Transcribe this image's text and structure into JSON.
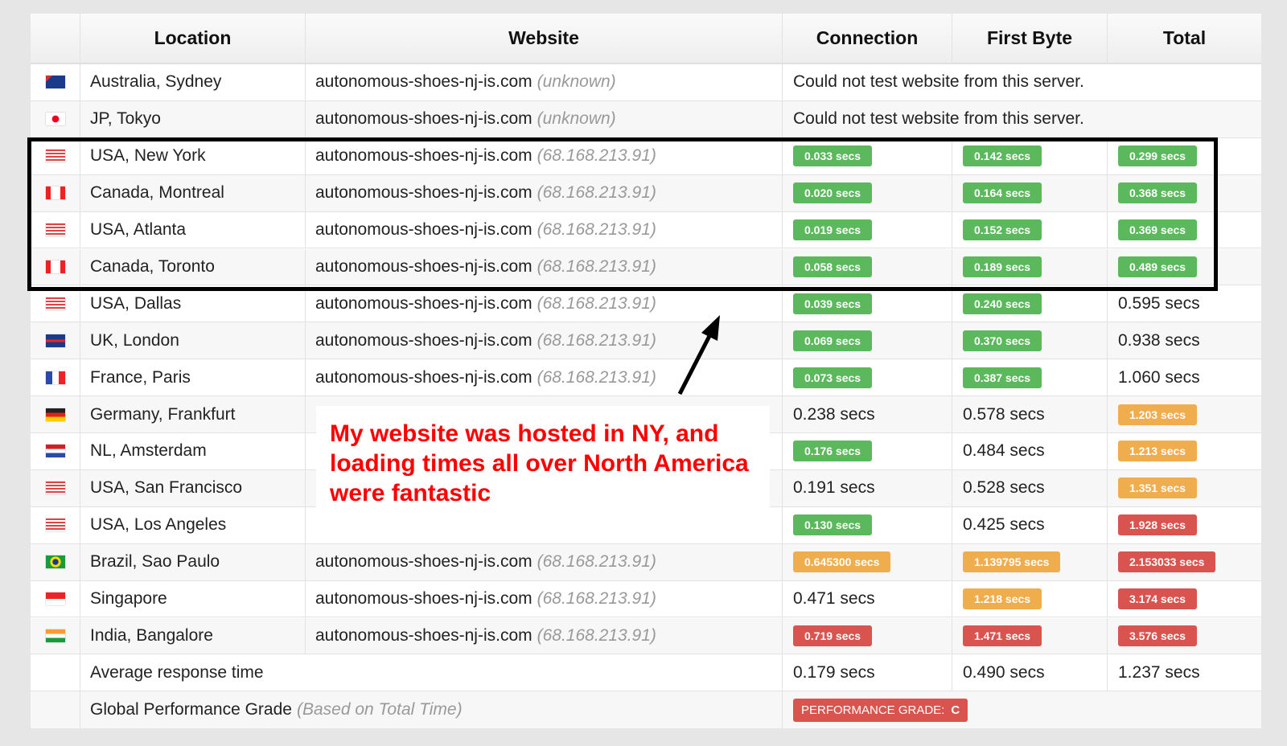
{
  "colors": {
    "good": "#5cb85c",
    "warn": "#f0ad4e",
    "bad": "#d9534f",
    "annotation": "#ff0000"
  },
  "headers": {
    "location": "Location",
    "website": "Website",
    "connection": "Connection",
    "first_byte": "First Byte",
    "total": "Total"
  },
  "rows": [
    {
      "flag": "australia",
      "location": "Australia, Sydney",
      "site": "autonomous-shoes-nj-is.com",
      "ip": "(unknown)",
      "message": "Could not test website from this server."
    },
    {
      "flag": "japan",
      "location": "JP, Tokyo",
      "site": "autonomous-shoes-nj-is.com",
      "ip": "(unknown)",
      "message": "Could not test website from this server."
    },
    {
      "flag": "usa",
      "location": "USA, New York",
      "site": "autonomous-shoes-nj-is.com",
      "ip": "(68.168.213.91)",
      "conn": {
        "v": "0.033 secs",
        "s": "green"
      },
      "fb": {
        "v": "0.142 secs",
        "s": "green"
      },
      "total": {
        "v": "0.299 secs",
        "s": "green"
      }
    },
    {
      "flag": "canada",
      "location": "Canada, Montreal",
      "site": "autonomous-shoes-nj-is.com",
      "ip": "(68.168.213.91)",
      "conn": {
        "v": "0.020 secs",
        "s": "green"
      },
      "fb": {
        "v": "0.164 secs",
        "s": "green"
      },
      "total": {
        "v": "0.368 secs",
        "s": "green"
      }
    },
    {
      "flag": "usa",
      "location": "USA, Atlanta",
      "site": "autonomous-shoes-nj-is.com",
      "ip": "(68.168.213.91)",
      "conn": {
        "v": "0.019 secs",
        "s": "green"
      },
      "fb": {
        "v": "0.152 secs",
        "s": "green"
      },
      "total": {
        "v": "0.369 secs",
        "s": "green"
      }
    },
    {
      "flag": "canada",
      "location": "Canada, Toronto",
      "site": "autonomous-shoes-nj-is.com",
      "ip": "(68.168.213.91)",
      "conn": {
        "v": "0.058 secs",
        "s": "green"
      },
      "fb": {
        "v": "0.189 secs",
        "s": "green"
      },
      "total": {
        "v": "0.489 secs",
        "s": "green"
      }
    },
    {
      "flag": "usa",
      "location": "USA, Dallas",
      "site": "autonomous-shoes-nj-is.com",
      "ip": "(68.168.213.91)",
      "conn": {
        "v": "0.039 secs",
        "s": "green"
      },
      "fb": {
        "v": "0.240 secs",
        "s": "green"
      },
      "total": {
        "v": "0.595 secs",
        "s": ""
      }
    },
    {
      "flag": "uk",
      "location": "UK, London",
      "site": "autonomous-shoes-nj-is.com",
      "ip": "(68.168.213.91)",
      "conn": {
        "v": "0.069 secs",
        "s": "green"
      },
      "fb": {
        "v": "0.370 secs",
        "s": "green"
      },
      "total": {
        "v": "0.938 secs",
        "s": ""
      }
    },
    {
      "flag": "france",
      "location": "France, Paris",
      "site": "autonomous-shoes-nj-is.com",
      "ip": "(68.168.213.91)",
      "conn": {
        "v": "0.073 secs",
        "s": "green"
      },
      "fb": {
        "v": "0.387 secs",
        "s": "green"
      },
      "total": {
        "v": "1.060 secs",
        "s": ""
      }
    },
    {
      "flag": "germany",
      "location": "Germany, Frankfurt",
      "conn": {
        "v": "0.238 secs",
        "s": ""
      },
      "fb": {
        "v": "0.578 secs",
        "s": ""
      },
      "total": {
        "v": "1.203 secs",
        "s": "orange"
      }
    },
    {
      "flag": "netherlands",
      "location": "NL, Amsterdam",
      "conn": {
        "v": "0.176 secs",
        "s": "green"
      },
      "fb": {
        "v": "0.484 secs",
        "s": ""
      },
      "total": {
        "v": "1.213 secs",
        "s": "orange"
      }
    },
    {
      "flag": "usa",
      "location": "USA, San Francisco",
      "conn": {
        "v": "0.191 secs",
        "s": ""
      },
      "fb": {
        "v": "0.528 secs",
        "s": ""
      },
      "total": {
        "v": "1.351 secs",
        "s": "orange"
      }
    },
    {
      "flag": "usa",
      "location": "USA, Los Angeles",
      "conn": {
        "v": "0.130 secs",
        "s": "green"
      },
      "fb": {
        "v": "0.425 secs",
        "s": ""
      },
      "total": {
        "v": "1.928 secs",
        "s": "red"
      }
    },
    {
      "flag": "brazil",
      "location": "Brazil, Sao Paulo",
      "site": "autonomous-shoes-nj-is.com",
      "ip": "(68.168.213.91)",
      "conn": {
        "v": "0.645300 secs",
        "s": "orange"
      },
      "fb": {
        "v": "1.139795 secs",
        "s": "orange"
      },
      "total": {
        "v": "2.153033 secs",
        "s": "red"
      }
    },
    {
      "flag": "singapore",
      "location": "Singapore",
      "site": "autonomous-shoes-nj-is.com",
      "ip": "(68.168.213.91)",
      "conn": {
        "v": "0.471 secs",
        "s": ""
      },
      "fb": {
        "v": "1.218 secs",
        "s": "orange"
      },
      "total": {
        "v": "3.174 secs",
        "s": "red"
      }
    },
    {
      "flag": "india",
      "location": "India, Bangalore",
      "site": "autonomous-shoes-nj-is.com",
      "ip": "(68.168.213.91)",
      "conn": {
        "v": "0.719 secs",
        "s": "red"
      },
      "fb": {
        "v": "1.471 secs",
        "s": "red"
      },
      "total": {
        "v": "3.576 secs",
        "s": "red"
      }
    }
  ],
  "average": {
    "label": "Average response time",
    "conn": "0.179 secs",
    "fb": "0.490 secs",
    "total": "1.237 secs"
  },
  "grade": {
    "label": "Global Performance Grade",
    "note": "(Based on Total Time)",
    "badge_label": "PERFORMANCE GRADE:",
    "value": "C"
  },
  "annotation": {
    "text": "My website was hosted in NY, and loading times all over North America were fantastic"
  }
}
